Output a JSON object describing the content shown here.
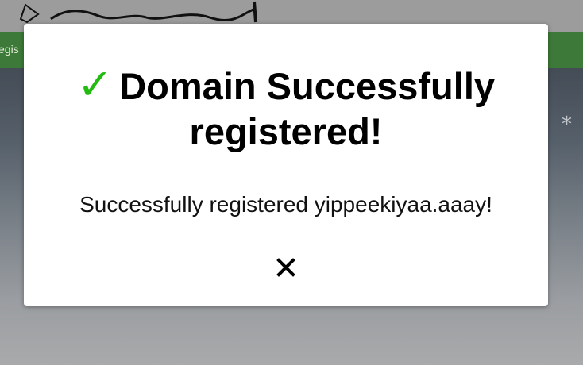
{
  "header": {
    "logo_icon": "handwritten-logo"
  },
  "navbar": {
    "partial_item": "egis"
  },
  "background": {
    "snowflake_glyph": "*"
  },
  "modal": {
    "check_glyph": "✓",
    "title": "Domain Successfully registered!",
    "message": "Successfully registered yippeekiyaa.aaay!",
    "close_icon": "close-icon",
    "colors": {
      "check": "#22bb0f",
      "navbar": "#3d7a39"
    }
  }
}
